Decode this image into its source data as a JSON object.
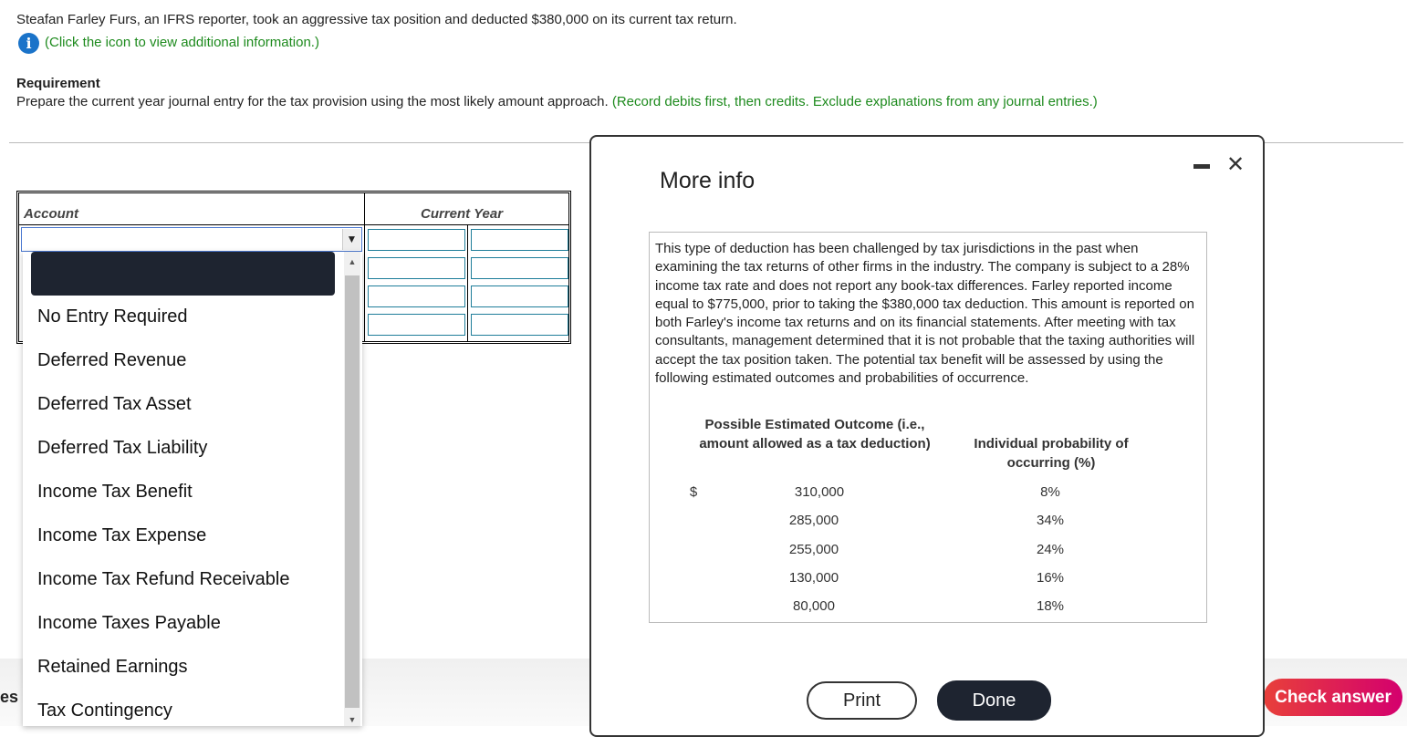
{
  "question": {
    "text": "Steafan Farley Furs, an IFRS reporter, took an aggressive tax position and deducted $380,000 on its current tax return.",
    "info_link": "(Click the icon to view additional information.)",
    "requirement_label": "Requirement",
    "requirement_text": "Prepare the current year journal entry for the tax provision using the most likely amount approach.",
    "requirement_note": "(Record debits first, then credits. Exclude explanations from any journal entries.)"
  },
  "journal": {
    "col_account": "Account",
    "col_current_year": "Current Year",
    "selected_account": ""
  },
  "dropdown": {
    "options": [
      "No Entry Required",
      "Deferred Revenue",
      "Deferred Tax Asset",
      "Deferred Tax Liability",
      "Income Tax Benefit",
      "Income Tax Expense",
      "Income Tax Refund Receivable",
      "Income Taxes Payable",
      "Retained Earnings",
      "Tax Contingency"
    ]
  },
  "modal": {
    "title": "More info",
    "minimize": "–",
    "close": "✕",
    "body": "This type of deduction has been challenged by tax jurisdictions in the past when examining the tax returns of other firms in the industry. The company is subject to a 28% income tax rate and does not report any book-tax differences. Farley reported income equal to $775,000, prior to taking the $380,000 tax deduction. This amount is reported on both Farley's income tax returns and on its financial statements. After meeting with tax consultants, management determined that it is not probable that the taxing authorities will accept the tax position taken. The potential tax benefit will be assessed by using the following estimated outcomes and probabilities of occurrence.",
    "table": {
      "col1": "Possible Estimated Outcome (i.e., amount allowed as a tax deduction)",
      "col2": "Individual probability of occurring (%)",
      "currency": "$",
      "rows": [
        {
          "amount": "310,000",
          "prob": "8%"
        },
        {
          "amount": "285,000",
          "prob": "34%"
        },
        {
          "amount": "255,000",
          "prob": "24%"
        },
        {
          "amount": "130,000",
          "prob": "16%"
        },
        {
          "amount": "80,000",
          "prob": "18%"
        }
      ]
    },
    "print": "Print",
    "done": "Done"
  },
  "footer": {
    "left_text": "es",
    "check_answer": "Check answer"
  },
  "colors": {
    "green": "#1d8a1d",
    "info_icon": "#1a73c9",
    "done_bg": "#1e2430",
    "check_grad_start": "#e8403a",
    "check_grad_end": "#d4006e"
  }
}
